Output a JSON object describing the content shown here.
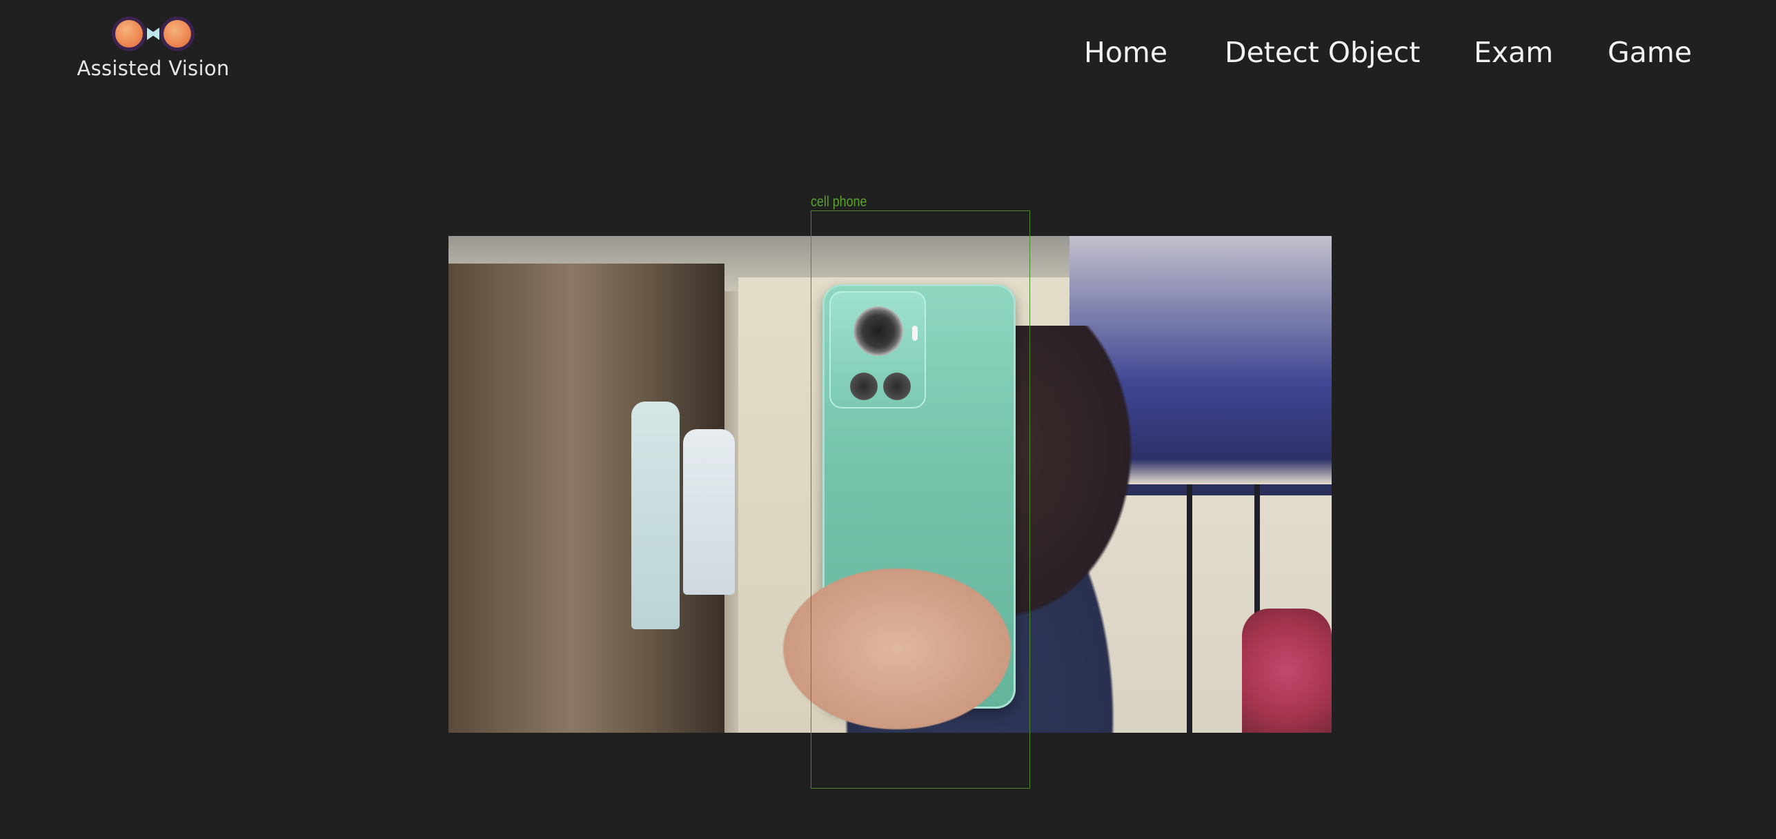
{
  "brand": {
    "name": "Assisted Vision",
    "logo_icon": "binoculars-icon"
  },
  "nav": {
    "items": [
      {
        "label": "Home"
      },
      {
        "label": "Detect Object"
      },
      {
        "label": "Exam"
      },
      {
        "label": "Game"
      }
    ]
  },
  "camera": {
    "detection": {
      "label": "cell phone",
      "box_color": "#4f8a2a"
    }
  }
}
